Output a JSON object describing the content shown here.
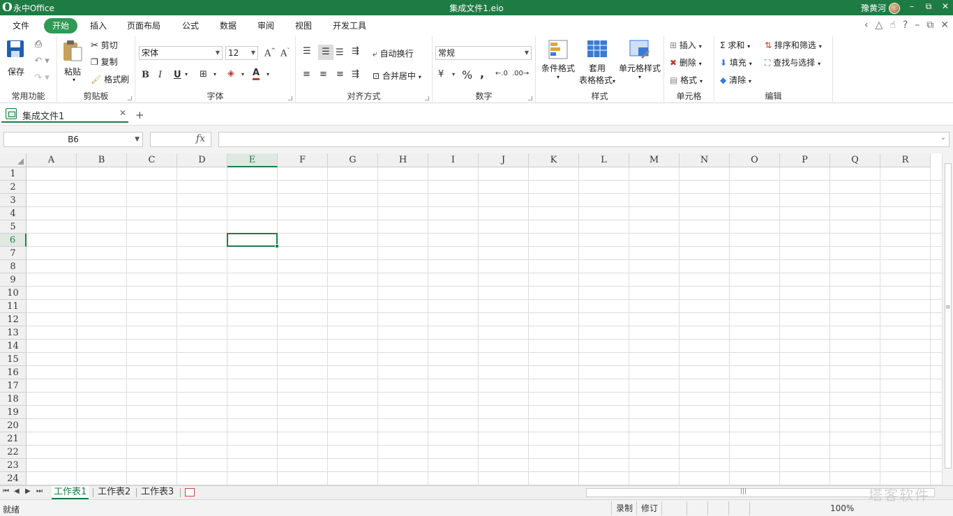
{
  "titlebar": {
    "app_o": "O",
    "app_name": "永中Office",
    "doc_title": "集成文件1.eio",
    "user": "豫黄河",
    "buttons": [
      "–",
      "◰",
      "–",
      "□",
      "✕"
    ]
  },
  "menu": {
    "items": [
      "文件",
      "开始",
      "插入",
      "页面布局",
      "公式",
      "数据",
      "审阅",
      "视图",
      "开发工具"
    ],
    "active": "开始"
  },
  "ribbon": {
    "common": {
      "save": "保存",
      "label": "常用功能"
    },
    "clipboard": {
      "paste": "粘贴",
      "cut": "剪切",
      "copy": "复制",
      "format_painter": "格式刷",
      "label": "剪贴板"
    },
    "font": {
      "name": "宋体",
      "size": "12",
      "bold": "B",
      "italic": "I",
      "underline": "U",
      "label": "字体"
    },
    "align": {
      "wrap": "自动换行",
      "merge": "合并居中",
      "label": "对齐方式"
    },
    "number": {
      "format": "常规",
      "currency": "¥",
      "percent": "%",
      "comma": ",",
      "label": "数字"
    },
    "styles": {
      "conditional": "条件格式",
      "table_1": "套用",
      "table_2": "表格格式",
      "cell_style": "单元格样式",
      "label": "样式"
    },
    "cells": {
      "insert": "插入",
      "delete": "删除",
      "format": "格式",
      "label": "单元格"
    },
    "edit": {
      "sum": "求和",
      "fill": "填充",
      "clear": "清除",
      "sort": "排序和筛选",
      "find": "查找与选择",
      "label": "编辑"
    }
  },
  "doctab": {
    "name": "集成文件1",
    "close": "✕",
    "add": "+"
  },
  "formula": {
    "cell_ref": "B6",
    "fx": "fx",
    "value": ""
  },
  "grid": {
    "columns": [
      "A",
      "B",
      "C",
      "D",
      "E",
      "F",
      "G",
      "H",
      "I",
      "J",
      "K",
      "L",
      "M",
      "N",
      "O",
      "P",
      "Q",
      "R"
    ],
    "rows": [
      "1",
      "2",
      "3",
      "4",
      "5",
      "6",
      "7",
      "8",
      "9",
      "10",
      "11",
      "12",
      "13",
      "14",
      "15",
      "16",
      "17",
      "18",
      "19",
      "20",
      "21",
      "22",
      "23",
      "24"
    ],
    "selected_column": "E",
    "selected_row": "6"
  },
  "sheets": {
    "tabs": [
      "工作表1",
      "工作表2",
      "工作表3"
    ],
    "active": "工作表1"
  },
  "status": {
    "ready": "就绪",
    "record": "录制",
    "revise": "修订",
    "zoom": "100%"
  },
  "watermark": "塔客软件"
}
